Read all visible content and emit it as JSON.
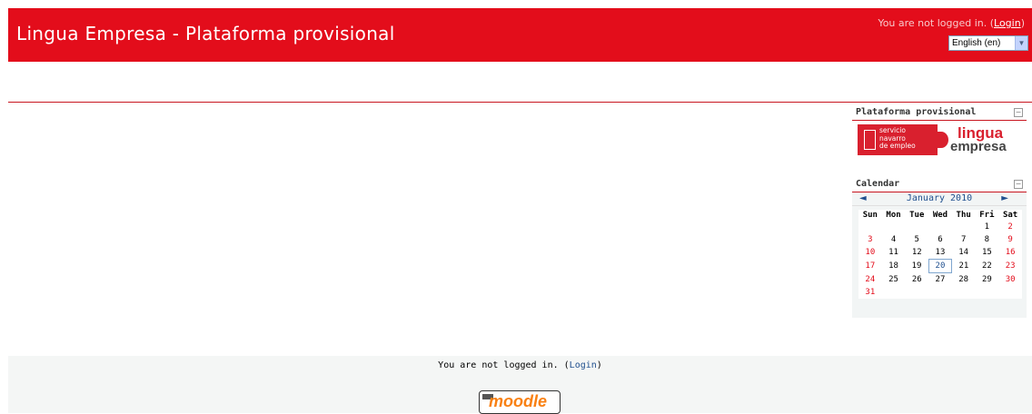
{
  "header": {
    "site_title": "Lingua Empresa - Plataforma provisional",
    "login_prefix": "You are not logged in. (",
    "login_link": "Login",
    "login_suffix": ")",
    "language": "English (en)"
  },
  "blocks": {
    "plataforma": {
      "title": "Plataforma provisional",
      "logo": {
        "sne_line1": "servicio",
        "sne_line2": "navarro",
        "sne_line3": "de empleo",
        "lingua": "lingua",
        "empresa": "empresa"
      }
    },
    "calendar": {
      "title": "Calendar",
      "month": "January 2010",
      "prev_icon": "◄",
      "next_icon": "►",
      "weekdays": [
        "Sun",
        "Mon",
        "Tue",
        "Wed",
        "Thu",
        "Fri",
        "Sat"
      ],
      "weeks": [
        [
          "",
          "",
          "",
          "",
          "",
          "1",
          "2"
        ],
        [
          "3",
          "4",
          "5",
          "6",
          "7",
          "8",
          "9"
        ],
        [
          "10",
          "11",
          "12",
          "13",
          "14",
          "15",
          "16"
        ],
        [
          "17",
          "18",
          "19",
          "20",
          "21",
          "22",
          "23"
        ],
        [
          "24",
          "25",
          "26",
          "27",
          "28",
          "29",
          "30"
        ],
        [
          "31",
          "",
          "",
          "",
          "",
          "",
          ""
        ]
      ],
      "today": "20"
    }
  },
  "footer": {
    "login_prefix": "You are not logged in. (",
    "login_link": "Login",
    "login_suffix": ")",
    "logo_text": "moodle"
  },
  "colors": {
    "brand_red": "#e30d1b",
    "link_blue": "#1f4f8e",
    "moodle_orange": "#f98012"
  }
}
